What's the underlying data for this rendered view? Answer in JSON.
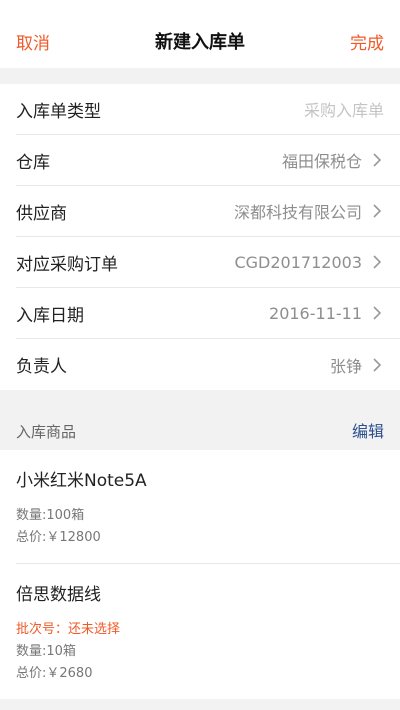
{
  "nav": {
    "cancel": "取消",
    "title": "新建入库单",
    "done": "完成"
  },
  "form": [
    {
      "label": "入库单类型",
      "value": "采购入库单",
      "placeholder": true,
      "chevron": false
    },
    {
      "label": "仓库",
      "value": "福田保税仓",
      "placeholder": false,
      "chevron": true
    },
    {
      "label": "供应商",
      "value": "深都科技有限公司",
      "placeholder": false,
      "chevron": true
    },
    {
      "label": "对应采购订单",
      "value": "CGD201712003",
      "placeholder": false,
      "chevron": true
    },
    {
      "label": "入库日期",
      "value": "2016-11-11",
      "placeholder": false,
      "chevron": true
    },
    {
      "label": "负责人",
      "value": "张铮",
      "placeholder": false,
      "chevron": true
    }
  ],
  "goods": {
    "title": "入库商品",
    "edit": "编辑",
    "items": [
      {
        "name": "小米红米Note5A",
        "qty": "数量:100箱",
        "total": "总价:￥12800"
      },
      {
        "name": "倍思数据线",
        "batch": "批次号：还未选择",
        "qty": "数量:10箱",
        "total": "总价:￥2680"
      }
    ]
  }
}
